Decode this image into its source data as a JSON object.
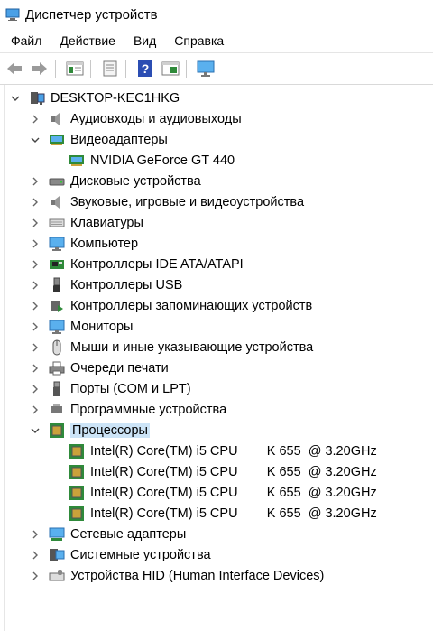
{
  "window": {
    "title": "Диспетчер устройств"
  },
  "menu": [
    "Файл",
    "Действие",
    "Вид",
    "Справка"
  ],
  "toolbar": [
    "back-icon",
    "forward-icon",
    "properties-icon",
    "update-driver-icon",
    "help-icon",
    "view-icon",
    "monitor-icon"
  ],
  "tree": {
    "root": "DESKTOP-KEC1HKG",
    "categories": [
      {
        "label": "Аудиовходы и аудиовыходы",
        "icon": "speaker-icon",
        "expanded": false
      },
      {
        "label": "Видеоадаптеры",
        "icon": "display-adapter-icon",
        "expanded": true,
        "children": [
          "NVIDIA GeForce GT 440"
        ]
      },
      {
        "label": "Дисковые устройства",
        "icon": "disk-icon",
        "expanded": false
      },
      {
        "label": "Звуковые, игровые и видеоустройства",
        "icon": "sound-icon",
        "expanded": false
      },
      {
        "label": "Клавиатуры",
        "icon": "keyboard-icon",
        "expanded": false
      },
      {
        "label": "Компьютер",
        "icon": "computer-icon",
        "expanded": false
      },
      {
        "label": "Контроллеры IDE ATA/ATAPI",
        "icon": "ide-icon",
        "expanded": false
      },
      {
        "label": "Контроллеры USB",
        "icon": "usb-icon",
        "expanded": false
      },
      {
        "label": "Контроллеры запоминающих устройств",
        "icon": "storage-icon",
        "expanded": false
      },
      {
        "label": "Мониторы",
        "icon": "monitor-icon",
        "expanded": false
      },
      {
        "label": "Мыши и иные указывающие устройства",
        "icon": "mouse-icon",
        "expanded": false
      },
      {
        "label": "Очереди печати",
        "icon": "printer-icon",
        "expanded": false
      },
      {
        "label": "Порты (COM и LPT)",
        "icon": "port-icon",
        "expanded": false
      },
      {
        "label": "Программные устройства",
        "icon": "software-device-icon",
        "expanded": false
      },
      {
        "label": "Процессоры",
        "icon": "processor-icon",
        "expanded": true,
        "selected": true,
        "children": [
          "Intel(R) Core(TM) i5 CPU        K 655  @ 3.20GHz",
          "Intel(R) Core(TM) i5 CPU        K 655  @ 3.20GHz",
          "Intel(R) Core(TM) i5 CPU        K 655  @ 3.20GHz",
          "Intel(R) Core(TM) i5 CPU        K 655  @ 3.20GHz"
        ]
      },
      {
        "label": "Сетевые адаптеры",
        "icon": "network-icon",
        "expanded": false
      },
      {
        "label": "Системные устройства",
        "icon": "system-icon",
        "expanded": false
      },
      {
        "label": "Устройства HID (Human Interface Devices)",
        "icon": "hid-icon",
        "expanded": false
      }
    ]
  },
  "colors": {
    "selection": "#cce4f7",
    "accent": "#1f6fbf"
  }
}
